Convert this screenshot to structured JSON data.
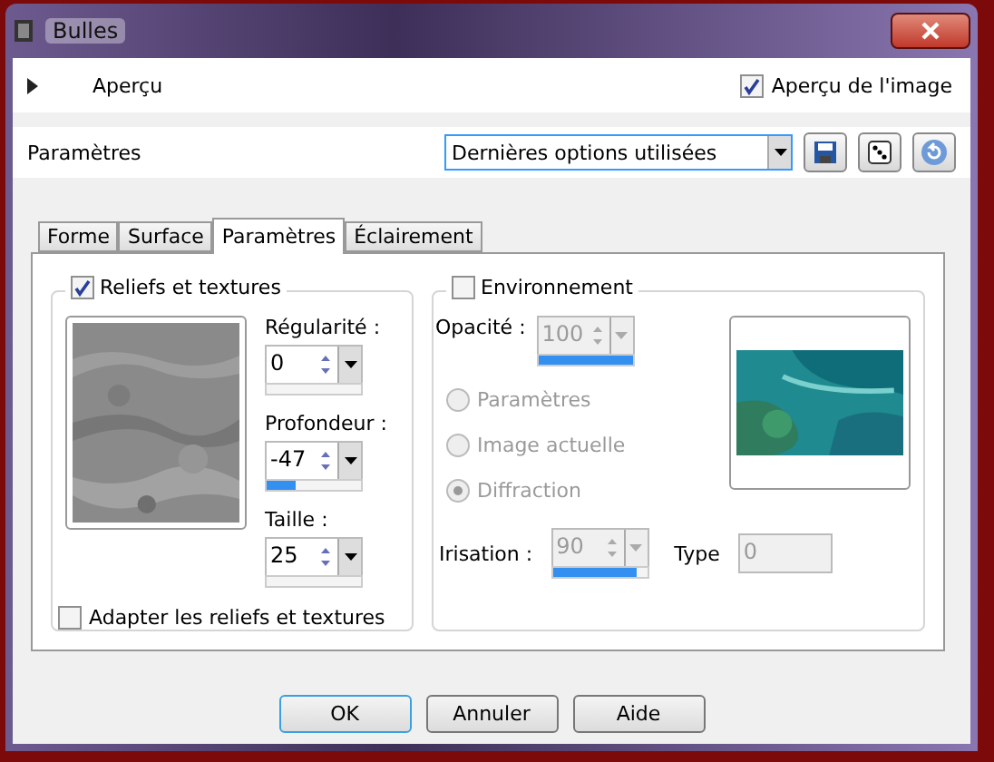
{
  "window": {
    "title": "Bulles"
  },
  "preview": {
    "label": "Aperçu",
    "expanded": false,
    "image_preview": {
      "label": "Aperçu de l'image",
      "checked": true
    }
  },
  "settings": {
    "label": "Paramètres",
    "preset": "Dernières options utilisées"
  },
  "tabs": [
    {
      "label": "Forme",
      "selected": false
    },
    {
      "label": "Surface",
      "selected": false
    },
    {
      "label": "Paramètres",
      "selected": true
    },
    {
      "label": "Éclairement",
      "selected": false
    }
  ],
  "reliefs": {
    "label": "Reliefs et textures",
    "checked": true,
    "fields": [
      {
        "label": "Régularité :",
        "value": "0"
      },
      {
        "label": "Profondeur :",
        "value": "-47",
        "level": 0.3
      },
      {
        "label": "Taille :",
        "value": "25"
      }
    ],
    "adapt": {
      "label": "Adapter les reliefs et textures",
      "checked": false
    }
  },
  "environment": {
    "label": "Environnement",
    "checked": false,
    "disabled": true,
    "opacity": {
      "label": "Opacité :",
      "value": "100",
      "level": 1
    },
    "options": [
      {
        "label": "Paramètres",
        "selected": false
      },
      {
        "label": "Image actuelle",
        "selected": false
      },
      {
        "label": "Diffraction",
        "selected": true
      }
    ],
    "iridescence": {
      "label": "Irisation :",
      "value": "90",
      "level": 0.9
    },
    "type": {
      "label": "Type",
      "value": "0"
    }
  },
  "buttons": [
    {
      "label": "OK",
      "default": true
    },
    {
      "label": "Annuler",
      "default": false
    },
    {
      "label": "Aide",
      "default": false
    }
  ]
}
